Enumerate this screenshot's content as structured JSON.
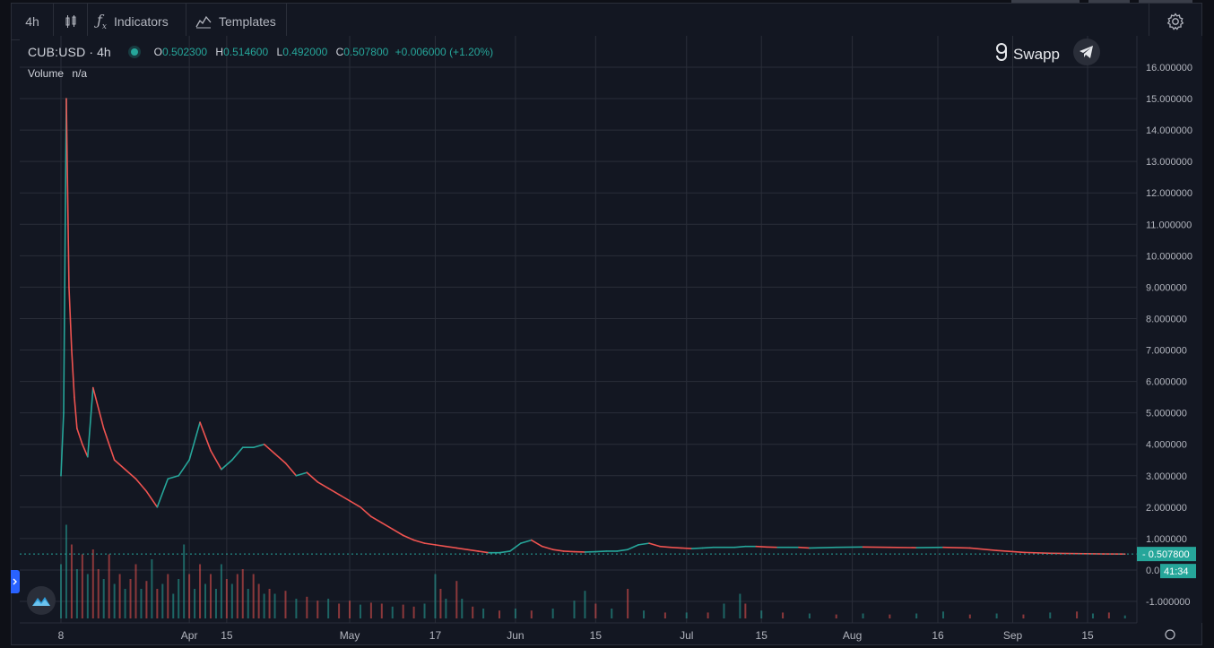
{
  "toolbar": {
    "interval": "4h",
    "indicators_label": "Indicators",
    "templates_label": "Templates"
  },
  "legend": {
    "symbol": "CUB:USD",
    "interval": "4h",
    "o_key": "O",
    "o_val": "0.502300",
    "h_key": "H",
    "h_val": "0.514600",
    "l_key": "L",
    "l_val": "0.492000",
    "c_key": "C",
    "c_val": "0.507800",
    "change": "+0.006000 (+1.20%)",
    "volume_label": "Volume",
    "volume_val": "n/a"
  },
  "brand": {
    "name": "Swapp"
  },
  "colors": {
    "background": "#131722",
    "grid": "#2a2e39",
    "up": "#26a69a",
    "down": "#ef5350",
    "text": "#b2b5be"
  },
  "icons": [
    "bar-chart-icon",
    "function-icon",
    "templates-icon",
    "settings-icon",
    "telegram-icon",
    "swapp-logo-icon",
    "tradingview-logo-icon",
    "settings-small-icon"
  ],
  "chart_data": {
    "type": "line",
    "title": "CUB:USD",
    "interval": "4h",
    "ylim": [
      -1.3,
      16.5
    ],
    "y_ticks": [
      "16.000000",
      "15.000000",
      "14.000000",
      "13.000000",
      "12.000000",
      "11.000000",
      "10.000000",
      "9.000000",
      "8.000000",
      "7.000000",
      "6.000000",
      "5.000000",
      "4.000000",
      "3.000000",
      "2.000000",
      "1.000000",
      "0.0",
      "-1.000000"
    ],
    "y_tick_values": [
      16,
      15,
      14,
      13,
      12,
      11,
      10,
      9,
      8,
      7,
      6,
      5,
      4,
      3,
      2,
      1,
      0,
      -1
    ],
    "x_ticks": [
      "8",
      "Apr",
      "15",
      "May",
      "17",
      "Jun",
      "15",
      "Jul",
      "15",
      "Aug",
      "16",
      "Sep",
      "15"
    ],
    "x_tick_days": [
      0,
      24,
      31,
      54,
      70,
      85,
      100,
      117,
      131,
      148,
      164,
      178,
      192
    ],
    "series": [
      {
        "days": [
          0,
          0.5,
          1,
          1.5,
          2,
          2.5,
          3,
          4,
          5,
          6,
          8,
          10,
          12,
          14,
          16,
          18,
          20,
          22,
          24,
          26,
          28,
          30,
          32,
          34,
          36,
          38,
          40,
          42,
          44,
          46,
          48,
          50,
          52,
          54,
          56,
          58,
          60,
          62,
          64,
          66,
          68,
          70,
          72,
          74,
          76,
          78,
          80,
          82,
          84,
          86,
          88,
          90,
          92,
          94,
          96,
          98,
          100,
          102,
          104,
          106,
          108,
          110,
          112,
          114,
          116,
          118,
          120,
          122,
          124,
          126,
          128,
          130,
          132,
          134,
          136,
          138,
          140,
          145,
          150,
          155,
          160,
          165,
          170,
          175,
          180,
          185,
          190,
          195,
          199
        ],
        "values": [
          3.0,
          5.0,
          15.0,
          9.0,
          7.0,
          5.5,
          4.5,
          4.0,
          3.6,
          5.8,
          4.5,
          3.5,
          3.2,
          2.9,
          2.5,
          2.0,
          2.9,
          3.0,
          3.5,
          4.7,
          3.8,
          3.2,
          3.5,
          3.9,
          3.9,
          4.0,
          3.7,
          3.4,
          3.0,
          3.1,
          2.8,
          2.6,
          2.4,
          2.2,
          2.0,
          1.7,
          1.5,
          1.3,
          1.1,
          0.95,
          0.85,
          0.8,
          0.75,
          0.7,
          0.65,
          0.6,
          0.55,
          0.55,
          0.6,
          0.85,
          0.95,
          0.75,
          0.65,
          0.6,
          0.58,
          0.57,
          0.58,
          0.6,
          0.6,
          0.65,
          0.8,
          0.85,
          0.75,
          0.72,
          0.7,
          0.68,
          0.7,
          0.72,
          0.72,
          0.72,
          0.75,
          0.75,
          0.73,
          0.72,
          0.72,
          0.72,
          0.7,
          0.72,
          0.73,
          0.72,
          0.71,
          0.72,
          0.7,
          0.62,
          0.56,
          0.53,
          0.52,
          0.51,
          0.5078
        ]
      }
    ],
    "last_price_label": "0.507800",
    "countdown": "41:34",
    "volume_ylim": [
      0,
      1
    ],
    "volume_bars": [
      {
        "d": 0,
        "v": 0.55,
        "u": 1
      },
      {
        "d": 1,
        "v": 0.95,
        "u": 1
      },
      {
        "d": 2,
        "v": 0.75,
        "u": 0
      },
      {
        "d": 3,
        "v": 0.5,
        "u": 1
      },
      {
        "d": 4,
        "v": 0.65,
        "u": 0
      },
      {
        "d": 5,
        "v": 0.45,
        "u": 1
      },
      {
        "d": 6,
        "v": 0.7,
        "u": 0
      },
      {
        "d": 7,
        "v": 0.5,
        "u": 0
      },
      {
        "d": 8,
        "v": 0.4,
        "u": 1
      },
      {
        "d": 9,
        "v": 0.65,
        "u": 0
      },
      {
        "d": 10,
        "v": 0.35,
        "u": 1
      },
      {
        "d": 11,
        "v": 0.45,
        "u": 0
      },
      {
        "d": 12,
        "v": 0.3,
        "u": 1
      },
      {
        "d": 13,
        "v": 0.4,
        "u": 0
      },
      {
        "d": 14,
        "v": 0.55,
        "u": 0
      },
      {
        "d": 15,
        "v": 0.3,
        "u": 1
      },
      {
        "d": 16,
        "v": 0.38,
        "u": 0
      },
      {
        "d": 17,
        "v": 0.6,
        "u": 1
      },
      {
        "d": 18,
        "v": 0.3,
        "u": 0
      },
      {
        "d": 19,
        "v": 0.35,
        "u": 1
      },
      {
        "d": 20,
        "v": 0.45,
        "u": 0
      },
      {
        "d": 21,
        "v": 0.25,
        "u": 1
      },
      {
        "d": 22,
        "v": 0.4,
        "u": 1
      },
      {
        "d": 23,
        "v": 0.75,
        "u": 1
      },
      {
        "d": 24,
        "v": 0.45,
        "u": 0
      },
      {
        "d": 25,
        "v": 0.3,
        "u": 1
      },
      {
        "d": 26,
        "v": 0.55,
        "u": 0
      },
      {
        "d": 27,
        "v": 0.35,
        "u": 1
      },
      {
        "d": 28,
        "v": 0.45,
        "u": 0
      },
      {
        "d": 29,
        "v": 0.3,
        "u": 1
      },
      {
        "d": 30,
        "v": 0.55,
        "u": 1
      },
      {
        "d": 31,
        "v": 0.4,
        "u": 0
      },
      {
        "d": 32,
        "v": 0.35,
        "u": 1
      },
      {
        "d": 33,
        "v": 0.45,
        "u": 0
      },
      {
        "d": 34,
        "v": 0.5,
        "u": 0
      },
      {
        "d": 35,
        "v": 0.3,
        "u": 1
      },
      {
        "d": 36,
        "v": 0.45,
        "u": 0
      },
      {
        "d": 37,
        "v": 0.35,
        "u": 0
      },
      {
        "d": 38,
        "v": 0.25,
        "u": 1
      },
      {
        "d": 39,
        "v": 0.3,
        "u": 0
      },
      {
        "d": 40,
        "v": 0.25,
        "u": 1
      },
      {
        "d": 42,
        "v": 0.28,
        "u": 0
      },
      {
        "d": 44,
        "v": 0.2,
        "u": 1
      },
      {
        "d": 46,
        "v": 0.22,
        "u": 0
      },
      {
        "d": 48,
        "v": 0.18,
        "u": 0
      },
      {
        "d": 50,
        "v": 0.2,
        "u": 1
      },
      {
        "d": 52,
        "v": 0.15,
        "u": 0
      },
      {
        "d": 54,
        "v": 0.18,
        "u": 0
      },
      {
        "d": 56,
        "v": 0.14,
        "u": 1
      },
      {
        "d": 58,
        "v": 0.16,
        "u": 0
      },
      {
        "d": 60,
        "v": 0.15,
        "u": 0
      },
      {
        "d": 62,
        "v": 0.12,
        "u": 1
      },
      {
        "d": 64,
        "v": 0.14,
        "u": 0
      },
      {
        "d": 66,
        "v": 0.12,
        "u": 0
      },
      {
        "d": 68,
        "v": 0.15,
        "u": 1
      },
      {
        "d": 70,
        "v": 0.45,
        "u": 1
      },
      {
        "d": 71,
        "v": 0.3,
        "u": 0
      },
      {
        "d": 72,
        "v": 0.2,
        "u": 1
      },
      {
        "d": 74,
        "v": 0.38,
        "u": 0
      },
      {
        "d": 75,
        "v": 0.2,
        "u": 1
      },
      {
        "d": 77,
        "v": 0.12,
        "u": 0
      },
      {
        "d": 79,
        "v": 0.1,
        "u": 1
      },
      {
        "d": 82,
        "v": 0.08,
        "u": 0
      },
      {
        "d": 85,
        "v": 0.1,
        "u": 1
      },
      {
        "d": 88,
        "v": 0.08,
        "u": 0
      },
      {
        "d": 92,
        "v": 0.1,
        "u": 1
      },
      {
        "d": 96,
        "v": 0.18,
        "u": 1
      },
      {
        "d": 98,
        "v": 0.28,
        "u": 1
      },
      {
        "d": 100,
        "v": 0.15,
        "u": 0
      },
      {
        "d": 103,
        "v": 0.1,
        "u": 1
      },
      {
        "d": 106,
        "v": 0.3,
        "u": 0
      },
      {
        "d": 109,
        "v": 0.08,
        "u": 1
      },
      {
        "d": 113,
        "v": 0.06,
        "u": 0
      },
      {
        "d": 117,
        "v": 0.06,
        "u": 1
      },
      {
        "d": 121,
        "v": 0.06,
        "u": 0
      },
      {
        "d": 124,
        "v": 0.15,
        "u": 1
      },
      {
        "d": 127,
        "v": 0.25,
        "u": 1
      },
      {
        "d": 128,
        "v": 0.15,
        "u": 0
      },
      {
        "d": 131,
        "v": 0.08,
        "u": 1
      },
      {
        "d": 135,
        "v": 0.06,
        "u": 0
      },
      {
        "d": 140,
        "v": 0.05,
        "u": 1
      },
      {
        "d": 145,
        "v": 0.04,
        "u": 0
      },
      {
        "d": 150,
        "v": 0.05,
        "u": 1
      },
      {
        "d": 155,
        "v": 0.04,
        "u": 0
      },
      {
        "d": 160,
        "v": 0.05,
        "u": 1
      },
      {
        "d": 165,
        "v": 0.07,
        "u": 1
      },
      {
        "d": 170,
        "v": 0.04,
        "u": 0
      },
      {
        "d": 175,
        "v": 0.05,
        "u": 1
      },
      {
        "d": 180,
        "v": 0.04,
        "u": 0
      },
      {
        "d": 185,
        "v": 0.06,
        "u": 1
      },
      {
        "d": 190,
        "v": 0.07,
        "u": 0
      },
      {
        "d": 193,
        "v": 0.05,
        "u": 1
      },
      {
        "d": 196,
        "v": 0.06,
        "u": 0
      },
      {
        "d": 199,
        "v": 0.03,
        "u": 1
      }
    ]
  }
}
